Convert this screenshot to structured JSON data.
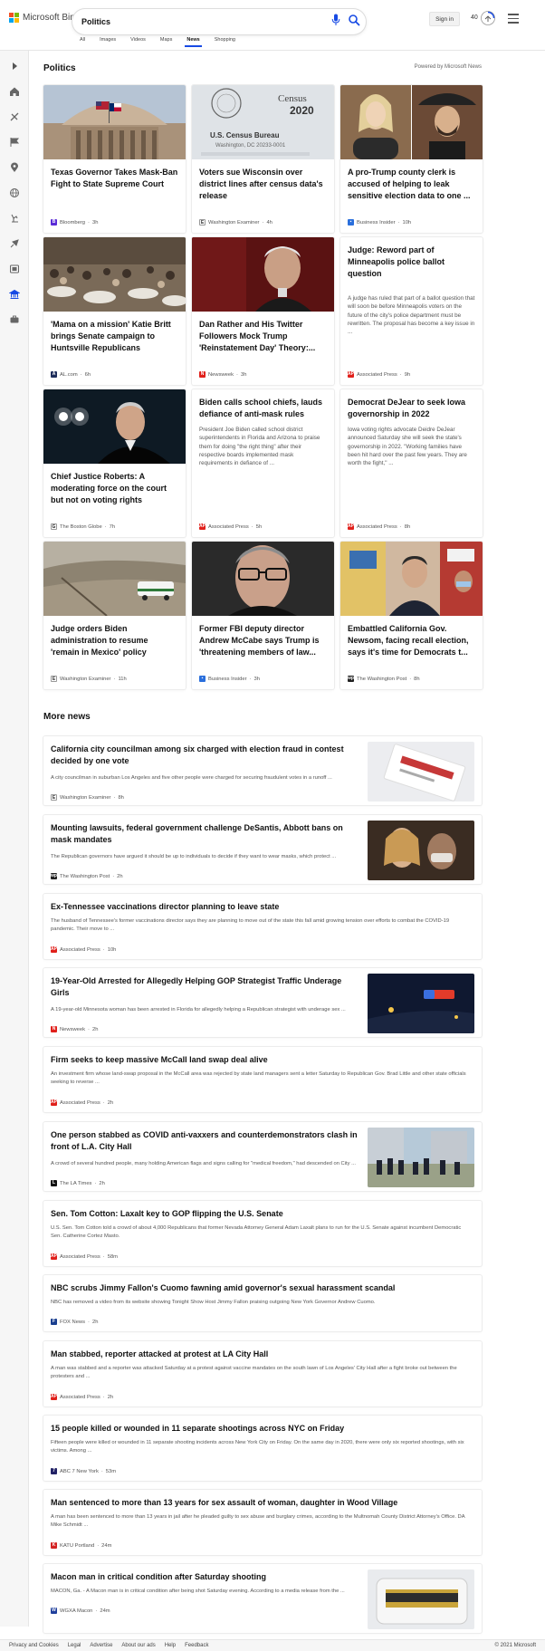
{
  "header": {
    "brand": "Microsoft Bing",
    "search_value": "Politics",
    "signin_label": "Sign in",
    "points": "40",
    "tabs": [
      "All",
      "Images",
      "Videos",
      "Maps",
      "News",
      "Shopping"
    ],
    "active_tab": "News"
  },
  "rail": {
    "icons": [
      "expand-icon",
      "home-icon",
      "sports-icon",
      "us-flag-icon",
      "local-icon",
      "world-icon",
      "science-icon",
      "technology-icon",
      "entertainment-icon",
      "politics-icon",
      "business-icon"
    ]
  },
  "politics": {
    "title": "Politics",
    "powered": "Powered by Microsoft News",
    "cards": [
      {
        "title": "Texas Governor Takes Mask-Ban Fight to State Supreme Court",
        "source": "Bloomberg",
        "time": "3h",
        "logo_color": "#5a2bd7",
        "logo_letter": "B"
      },
      {
        "title": "Voters sue Wisconsin over district lines after census data's release",
        "source": "Washington Examiner",
        "time": "4h",
        "logo_color": "#333333",
        "logo_letter": "E"
      },
      {
        "title": "A pro-Trump county clerk is accused of helping to leak sensitive election data to one ...",
        "source": "Business Insider",
        "time": "10h",
        "logo_color": "#2a6fdc",
        "logo_letter": "BI"
      },
      {
        "title": "'Mama on a mission' Katie Britt brings Senate campaign to Huntsville Republicans",
        "source": "AL.com",
        "time": "6h",
        "logo_color": "#1d2c5a",
        "logo_letter": "AL"
      },
      {
        "title": "Dan Rather and His Twitter Followers Mock Trump 'Reinstatement Day' Theory:...",
        "source": "Newsweek",
        "time": "3h",
        "logo_color": "#e0201b",
        "logo_letter": "N"
      },
      {
        "title": "Judge: Reword part of Minneapolis police ballot question",
        "snippet": "A judge has ruled that part of a ballot question that will soon be before Minneapolis voters on the future of the city's police department must be rewritten. The proposal has become a key issue in ...",
        "source": "Associated Press",
        "time": "9h",
        "logo_color": "#e0201b",
        "logo_letter": "AP"
      },
      {
        "title": "Chief Justice Roberts: A moderating force on the court but not on voting rights",
        "source": "The Boston Globe",
        "time": "7h",
        "logo_color": "#222222",
        "logo_letter": "G"
      },
      {
        "title": "Biden calls school chiefs, lauds defiance of anti-mask rules",
        "snippet": "President Joe Biden called school district superintendents in Florida and Arizona to praise them for doing \"the right thing\" after their respective boards implemented mask requirements in defiance of ...",
        "source": "Associated Press",
        "time": "5h",
        "logo_color": "#e0201b",
        "logo_letter": "AP"
      },
      {
        "title": "Democrat DeJear to seek Iowa governorship in 2022",
        "snippet": "Iowa voting rights advocate Deidre DeJear announced Saturday she will seek the state's governorship in 2022. \"Working families have been hit hard over the past few years. They are worth the fight,\" ...",
        "source": "Associated Press",
        "time": "8h",
        "logo_color": "#e0201b",
        "logo_letter": "AP"
      },
      {
        "title": "Judge orders Biden administration to resume 'remain in Mexico' policy",
        "source": "Washington Examiner",
        "time": "11h",
        "logo_color": "#333333",
        "logo_letter": "E"
      },
      {
        "title": "Former FBI deputy director Andrew McCabe says Trump is 'threatening members of law...",
        "source": "Business Insider",
        "time": "3h",
        "logo_color": "#2a6fdc",
        "logo_letter": "BI"
      },
      {
        "title": "Embattled California Gov. Newsom, facing recall election, says it's time for Democrats t...",
        "source": "The Washington Post",
        "time": "8h",
        "logo_color": "#222222",
        "logo_letter": "wp"
      }
    ]
  },
  "more_news": {
    "title": "More news",
    "items": [
      {
        "title": "California city councilman among six charged with election fraud in contest decided by one vote",
        "snippet": "A city councilman in suburban Los Angeles and five other people were charged for securing fraudulent votes in a runoff ...",
        "source": "Washington Examiner",
        "time": "8h",
        "logo_color": "#333333",
        "logo_letter": "E"
      },
      {
        "title": "Mounting lawsuits, federal government challenge DeSantis, Abbott bans on mask mandates",
        "snippet": "The Republican governors have argued it should be up to individuals to decide if they want to wear masks, which protect ...",
        "source": "The Washington Post",
        "time": "2h",
        "logo_color": "#222222",
        "logo_letter": "wp"
      },
      {
        "title": "Ex-Tennessee vaccinations director planning to leave state",
        "snippet": "The husband of Tennessee's former vaccinations director says they are planning to move out of the state this fall amid growing tension over efforts to combat the COVID-19 pandemic. Their move to ...",
        "source": "Associated Press",
        "time": "10h",
        "logo_color": "#e0201b",
        "logo_letter": "AP"
      },
      {
        "title": "19-Year-Old Arrested for Allegedly Helping GOP Strategist Traffic Underage Girls",
        "snippet": "A 19-year-old Minnesota woman has been arrested in Florida for allegedly helping a Republican strategist with underage sex ...",
        "source": "Newsweek",
        "time": "2h",
        "logo_color": "#e0201b",
        "logo_letter": "N"
      },
      {
        "title": "Firm seeks to keep massive McCall land swap deal alive",
        "snippet": "An investment firm whose land-swap proposal in the McCall area was rejected by state land managers sent a letter Saturday to Republican Gov. Brad Little and other state officials seeking to reverse ...",
        "source": "Associated Press",
        "time": "2h",
        "logo_color": "#e0201b",
        "logo_letter": "AP"
      },
      {
        "title": "One person stabbed as COVID anti-vaxxers and counterdemonstrators clash in front of L.A. City Hall",
        "snippet": "A crowd of several hundred people, many holding American flags and signs calling for \"medical freedom,\" had descended on City ...",
        "source": "The LA Times",
        "time": "2h",
        "logo_color": "#111111",
        "logo_letter": "L"
      },
      {
        "title": "Sen. Tom Cotton: Laxalt key to GOP flipping the U.S. Senate",
        "snippet": "U.S. Sen. Tom Cotton told a crowd of about 4,000 Republicans that former Nevada Attorney General Adam Laxalt plans to run for the U.S. Senate against incumbent Democratic Sen. Catherine Cortez Masto.",
        "source": "Associated Press",
        "time": "58m",
        "logo_color": "#e0201b",
        "logo_letter": "AP"
      },
      {
        "title": "NBC scrubs Jimmy Fallon's Cuomo fawning amid governor's sexual harassment scandal",
        "snippet": "NBC has removed a video from its website showing Tonight Show Host Jimmy Fallon praising outgoing New York Governor Andrew Cuomo.",
        "source": "FOX News",
        "time": "2h",
        "logo_color": "#1a3f8f",
        "logo_letter": "F"
      },
      {
        "title": "Man stabbed, reporter attacked at protest at LA City Hall",
        "snippet": "A man was stabbed and a reporter was attacked Saturday at a protest against vaccine mandates on the south lawn of Los Angeles' City Hall after a fight broke out between the protesters and ...",
        "source": "Associated Press",
        "time": "2h",
        "logo_color": "#e0201b",
        "logo_letter": "AP"
      },
      {
        "title": "15 people killed or wounded in 11 separate shootings across NYC on Friday",
        "snippet": "Fifteen people were killed or wounded in 11 separate shooting incidents across New York City on Friday. On the same day in 2020, there were only six reported shootings, with six victims. Among ...",
        "source": "ABC 7 New York",
        "time": "53m",
        "logo_color": "#222266",
        "logo_letter": "7"
      },
      {
        "title": "Man sentenced to more than 13 years for sex assault of woman, daughter in Wood Village",
        "snippet": "A man has been sentenced to more than 13 years in jail after he pleaded guilty to sex abuse and burglary crimes, according to the Multnomah County District Attorney's Office. DA Mike Schmidt ...",
        "source": "KATU Portland",
        "time": "24m",
        "logo_color": "#d42424",
        "logo_letter": "K"
      },
      {
        "title": "Macon man in critical condition after Saturday shooting",
        "snippet": "MACON, Ga. - A Macon man is in critical condition after being shot Saturday evening. According to a media release from the ...",
        "source": "WGXA Macon",
        "time": "24m",
        "logo_color": "#1f3f9c",
        "logo_letter": "W"
      }
    ]
  },
  "footer": {
    "links": [
      "Privacy and Cookies",
      "Legal",
      "Advertise",
      "About our ads",
      "Help",
      "Feedback"
    ],
    "copyright": "© 2021 Microsoft"
  }
}
